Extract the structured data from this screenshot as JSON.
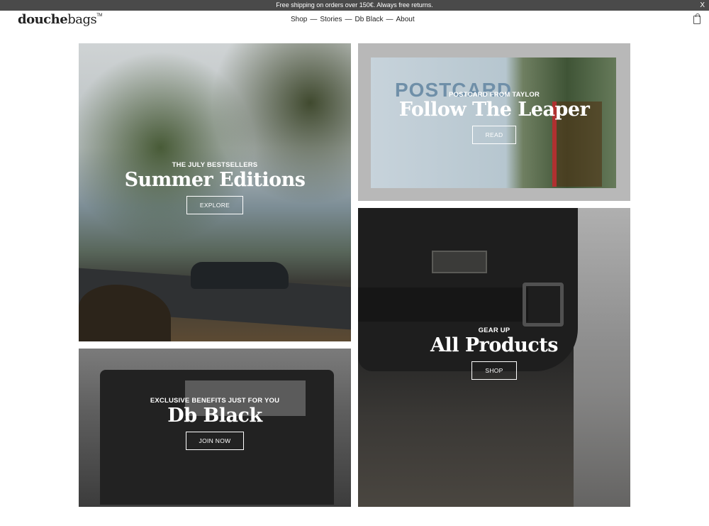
{
  "announcement": {
    "text": "Free shipping on orders over 150€. Always free returns.",
    "close_label": "X"
  },
  "header": {
    "logo_bold": "douche",
    "logo_rest": "bags",
    "logo_tm": "TM",
    "nav": [
      {
        "label": "Shop"
      },
      {
        "label": "Stories"
      },
      {
        "label": "Db Black"
      },
      {
        "label": "About"
      }
    ],
    "nav_separator": "—",
    "cart_icon": "shopping-bag-icon"
  },
  "tiles": {
    "summer": {
      "eyebrow": "THE JULY BESTSELLERS",
      "headline": "Summer Editions",
      "cta": "EXPLORE"
    },
    "postcard": {
      "stamp": "POSTCARD",
      "eyebrow": "POSTCARD FROM TAYLOR",
      "headline": "Follow The Leaper",
      "cta": "READ"
    },
    "black": {
      "eyebrow": "EXCLUSIVE BENEFITS JUST FOR YOU",
      "headline": "Db Black",
      "cta": "JOIN NOW"
    },
    "products": {
      "eyebrow": "GEAR UP",
      "headline": "All Products",
      "cta": "SHOP"
    }
  }
}
